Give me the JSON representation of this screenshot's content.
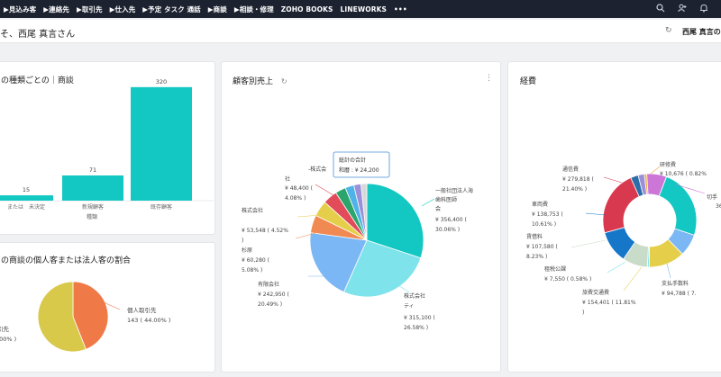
{
  "nav": {
    "items": [
      "▶見込み客",
      "▶連絡先",
      "▶取引先",
      "▶仕入先",
      "▶予定 タスク 通話",
      "▶商談",
      "▶相談・修理",
      "ZOHO BOOKS",
      "LINEWORKS",
      "•••"
    ],
    "icons": [
      "search-icon",
      "user-add-icon",
      "bell-icon"
    ]
  },
  "greeting": {
    "text": "そ、西尾 真言さん",
    "user": "西尾 真言の"
  },
  "card_deals_by_type": {
    "title": "の種類ごとの｜商談",
    "xlabel": "種類"
  },
  "card_customer_ratio": {
    "title": "の商談の個人客または法人客の割合",
    "labels": [
      {
        "line1": "個人取引先",
        "line2": "143 ( 44.00% )"
      },
      {
        "line1": "引先",
        "line2": ".00% )"
      }
    ]
  },
  "card_sales_by_customer": {
    "title": "顧客別売上",
    "tooltip_title": "総計の合計",
    "tooltip_value": "和暦 : ¥ 24,200",
    "labels": [
      {
        "l1": "一般社団法人海",
        "l2": "歯科医師",
        "l3": "会",
        "l4": "¥ 356,400 (",
        "l5": "30.06% )"
      },
      {
        "l1": "株式会社",
        "l2": "ティ",
        "l3": "¥ 315,100 (",
        "l4": "26.58% )"
      },
      {
        "l1": "有限会社",
        "l2": "¥ 242,950 (",
        "l3": "20.49% )"
      },
      {
        "l1": "杉原",
        "l2": "¥ 60,280 (",
        "l3": "5.08% )"
      },
      {
        "l1": "株式会社",
        "l2": "¥ 53,548 ( 4.52%",
        "l3": ")"
      },
      {
        "l1": "社",
        "l2": "¥ 48,400 (",
        "l3": "4.08% )"
      },
      {
        "l1": "-株式会"
      }
    ]
  },
  "card_expenses": {
    "title": "経費",
    "labels": [
      {
        "l1": "通信費",
        "l2": "¥ 279,818 (",
        "l3": "21.40% )"
      },
      {
        "l1": "車両費",
        "l2": "¥ 138,753 (",
        "l3": "10.61% )"
      },
      {
        "l1": "賃借料",
        "l2": "¥ 107,580 (",
        "l3": "8.23% )"
      },
      {
        "l1": "租税公課",
        "l2": "¥ 7,550 ( 0.58% )"
      },
      {
        "l1": "旅費交通費",
        "l2": "¥ 154,401 ( 11.81%",
        "l3": ")"
      },
      {
        "l1": "支払手数料",
        "l2": "¥ 94,788 ( 7."
      },
      {
        "l1": "研修費",
        "l2": "¥ 10,676 ( 0.82%"
      },
      {
        "l1": "切手"
      },
      {
        "l1": "36"
      }
    ]
  },
  "chart_data": [
    {
      "type": "bar",
      "title": "の種類ごとの｜商談",
      "xlabel": "種類",
      "ylabel": "",
      "categories": [
        "または　未決定",
        "新規顧客",
        "既存顧客"
      ],
      "values": [
        15,
        71,
        320
      ],
      "value_labels": [
        "15",
        "71",
        "320"
      ],
      "ylim": [
        0,
        350
      ],
      "color": "#13c7c2"
    },
    {
      "type": "pie",
      "title": "の商談の個人客または法人客の割合",
      "slices": [
        {
          "label": "個人取引先",
          "value": 143,
          "percent": 44.0,
          "color": "#ef7a48"
        },
        {
          "label": "引先",
          "value": null,
          "percent": 56.0,
          "color": "#d8c94a"
        }
      ]
    },
    {
      "type": "pie",
      "title": "顧客別売上",
      "slices": [
        {
          "label": "一般社団法人海 歯科医師 会",
          "value": 356400,
          "percent": 30.06,
          "color": "#13c7c2"
        },
        {
          "label": "株式会社 ティ",
          "value": 315100,
          "percent": 26.58,
          "color": "#7ee3ea"
        },
        {
          "label": "有限会社",
          "value": 242950,
          "percent": 20.49,
          "color": "#7cb7f5"
        },
        {
          "label": "杉原",
          "value": 60280,
          "percent": 5.08,
          "color": "#f08a52"
        },
        {
          "label": "株式会社",
          "value": 53548,
          "percent": 4.52,
          "color": "#e5cf4a"
        },
        {
          "label": "社",
          "value": 48400,
          "percent": 4.08,
          "color": "#e24b5a"
        },
        {
          "label": "-株式会",
          "value": null,
          "percent": 3.0,
          "color": "#2ba56b"
        },
        {
          "label": "",
          "value": null,
          "percent": 2.5,
          "color": "#4fb3e8"
        },
        {
          "label": "和暦",
          "value": 24200,
          "percent": 2.04,
          "color": "#9b8fd8"
        },
        {
          "label": "",
          "value": null,
          "percent": 1.65,
          "color": "#d8d8d8"
        }
      ]
    },
    {
      "type": "pie",
      "title": "経費",
      "donut": true,
      "slices": [
        {
          "label": "研修費",
          "value": 10676,
          "percent": 0.82,
          "color": "#f0a93c"
        },
        {
          "label": "切手",
          "value": null,
          "percent": 6.5,
          "color": "#cc77d8"
        },
        {
          "label": "",
          "value": null,
          "percent": 23.0,
          "color": "#13c7c2"
        },
        {
          "label": "支払手数料",
          "value": 94788,
          "percent": 7.25,
          "color": "#7cb7f5"
        },
        {
          "label": "旅費交通費",
          "value": 154401,
          "percent": 11.81,
          "color": "#e5cf4a"
        },
        {
          "label": "租税公課",
          "value": 7550,
          "percent": 0.58,
          "color": "#7ee3ea"
        },
        {
          "label": "賃借料",
          "value": 107580,
          "percent": 8.23,
          "color": "#c9dbc9"
        },
        {
          "label": "車両費",
          "value": 138753,
          "percent": 10.61,
          "color": "#1677c9"
        },
        {
          "label": "通信費",
          "value": 279818,
          "percent": 21.4,
          "color": "#d9394f"
        },
        {
          "label": "",
          "value": null,
          "percent": 2.5,
          "color": "#2b6ea8"
        },
        {
          "label": "",
          "value": null,
          "percent": 2.0,
          "color": "#9b8fd8"
        }
      ]
    }
  ]
}
